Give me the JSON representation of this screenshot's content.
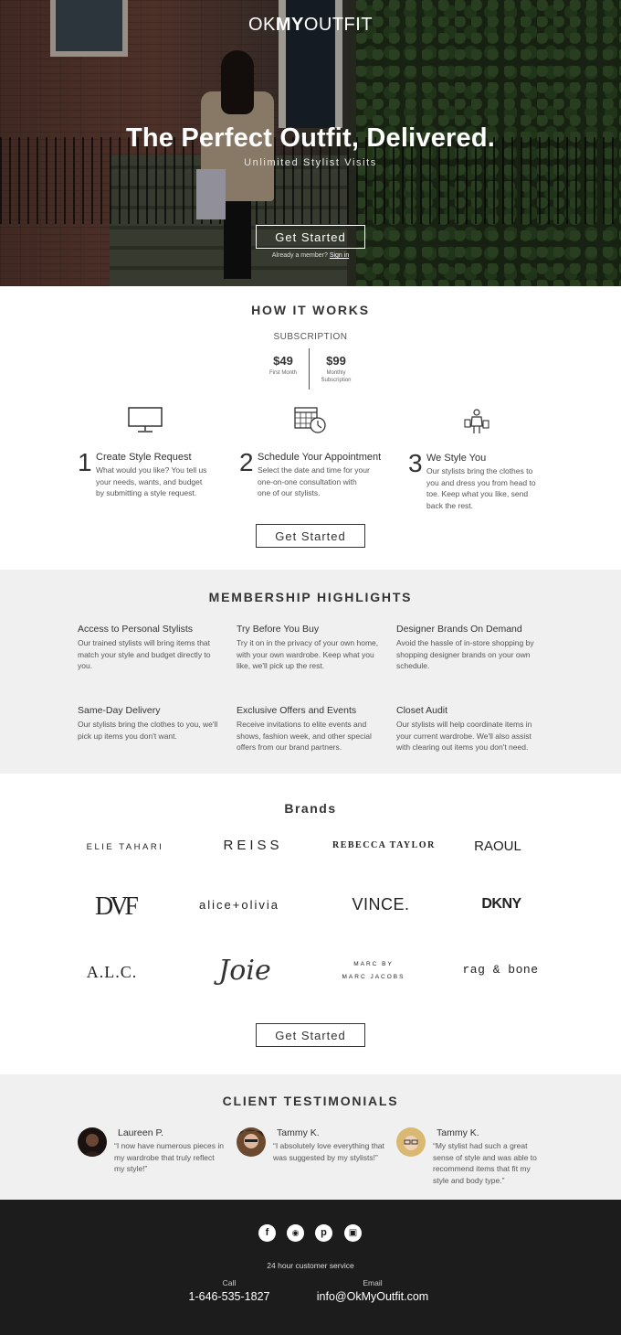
{
  "hero": {
    "logo_light_1": "OK",
    "logo_bold": "MY",
    "logo_light_2": "OUTFIT",
    "headline": "The Perfect Outfit, Delivered.",
    "subline": "Unlimited Stylist Visits",
    "cta": "Get Started",
    "member_text": "Already a member?",
    "sign_in": "Sign in"
  },
  "how": {
    "title": "HOW IT WORKS",
    "subscription_label": "SUBSCRIPTION",
    "prices": [
      {
        "amount": "$49",
        "caption": "First Month"
      },
      {
        "amount": "$99",
        "caption": "Monthly Subscription"
      }
    ],
    "steps": [
      {
        "num": "1",
        "title": "Create Style Request",
        "desc": "What would you like? You tell us your needs, wants, and budget by submitting a style request.",
        "icon": "monitor-icon"
      },
      {
        "num": "2",
        "title": "Schedule Your Appointment",
        "desc": "Select the date and time for your one-on-one consultation with one of our stylists.",
        "icon": "calendar-clock-icon"
      },
      {
        "num": "3",
        "title": "We Style You",
        "desc": "Our stylists bring the clothes to you and dress you from head to toe. Keep what you like, send back the rest.",
        "icon": "shopper-icon"
      }
    ],
    "cta": "Get Started"
  },
  "highlights": {
    "title": "MEMBERSHIP HIGHLIGHTS",
    "items": [
      {
        "title": "Access to Personal Stylists",
        "desc": "Our trained stylists will bring items that match your style and budget directly to you."
      },
      {
        "title": "Try Before You Buy",
        "desc": "Try it on in the privacy of your own home, with your own wardrobe. Keep what you like, we'll pick up the rest."
      },
      {
        "title": "Designer Brands On Demand",
        "desc": "Avoid the hassle of in-store shopping by shopping designer brands on your own schedule."
      },
      {
        "title": "Same-Day Delivery",
        "desc": "Our stylists bring the clothes to you, we'll pick up items you don't want."
      },
      {
        "title": "Exclusive Offers and Events",
        "desc": "Receive invitations to elite events and shows, fashion week, and other special offers from our brand partners."
      },
      {
        "title": "Closet Audit",
        "desc": "Our stylists will help coordinate items in your current wardrobe. We'll also assist with clearing out items you don't need."
      }
    ]
  },
  "brands": {
    "title": "Brands",
    "items": [
      "ELIE TAHARI",
      "REISS",
      "REBECCA TAYLOR",
      "RAOUL",
      "DVF",
      "alice+olivia",
      "VINCE.",
      "DKNY",
      "A.L.C.",
      "Joie",
      "MARC BY",
      "MARC JACOBS",
      "rag & bone"
    ],
    "cta": "Get Started"
  },
  "testimonials": {
    "title": "CLIENT TESTIMONIALS",
    "items": [
      {
        "name": "Laureen P.",
        "quote": "“I now have numerous pieces in my wardrobe that truly reflect my style!”",
        "avatar": "#1a1210"
      },
      {
        "name": "Tammy K.",
        "quote": "“I absolutely love everything that was suggested by my stylists!”",
        "avatar": "#6b4a30"
      },
      {
        "name": "Tammy K.",
        "quote": "“My stylist had such a great sense of style and was able to recommend items that fit my style and body type.”",
        "avatar": "#d9b872"
      }
    ]
  },
  "footer": {
    "social": [
      "facebook-icon",
      "twitter-icon",
      "pinterest-icon",
      "instagram-icon"
    ],
    "service": "24 hour customer service",
    "call_label": "Call",
    "call_value": "1-646-535-1827",
    "email_label": "Email",
    "email_value": "info@OkMyOutfit.com"
  }
}
